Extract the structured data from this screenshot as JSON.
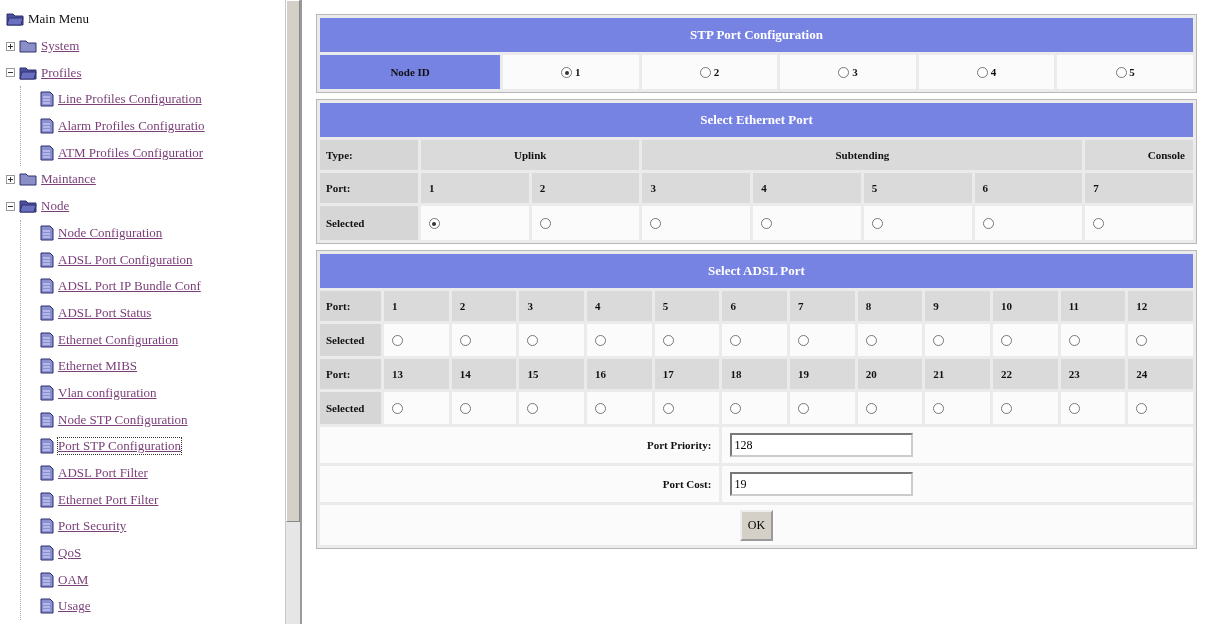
{
  "tree": {
    "label": "Main Menu",
    "children": [
      {
        "label": "System",
        "kind": "folder",
        "expanded": false
      },
      {
        "label": "Profiles",
        "kind": "folder",
        "expanded": true,
        "children": [
          {
            "label": "Line Profiles Configuration",
            "kind": "page"
          },
          {
            "label": "Alarm Profiles Configuratio",
            "kind": "page"
          },
          {
            "label": "ATM Profiles Configuratior",
            "kind": "page"
          }
        ]
      },
      {
        "label": "Maintance",
        "kind": "folder",
        "expanded": false
      },
      {
        "label": "Node",
        "kind": "folder",
        "expanded": true,
        "children": [
          {
            "label": "Node Configuration",
            "kind": "page"
          },
          {
            "label": "ADSL Port Configuration",
            "kind": "page"
          },
          {
            "label": "ADSL Port IP Bundle Conf",
            "kind": "page"
          },
          {
            "label": "ADSL Port Status",
            "kind": "page"
          },
          {
            "label": "Ethernet Configuration",
            "kind": "page"
          },
          {
            "label": "Ethernet MIBS",
            "kind": "page"
          },
          {
            "label": "Vlan configuration",
            "kind": "page"
          },
          {
            "label": "Node STP Configuration",
            "kind": "page"
          },
          {
            "label": "Port STP Configuration",
            "kind": "page",
            "selected": true
          },
          {
            "label": "ADSL Port Filter",
            "kind": "page"
          },
          {
            "label": "Ethernet Port Filter",
            "kind": "page"
          },
          {
            "label": "Port Security",
            "kind": "page"
          },
          {
            "label": "QoS",
            "kind": "page"
          },
          {
            "label": "OAM",
            "kind": "page"
          },
          {
            "label": "Usage",
            "kind": "page"
          }
        ]
      }
    ]
  },
  "stp": {
    "title": "STP Port Configuration",
    "node_label": "Node ID",
    "nodes": [
      {
        "label": "1",
        "selected": true
      },
      {
        "label": "2",
        "selected": false
      },
      {
        "label": "3",
        "selected": false
      },
      {
        "label": "4",
        "selected": false
      },
      {
        "label": "5",
        "selected": false
      }
    ]
  },
  "ethernet": {
    "title": "Select Ethernet Port",
    "type_label": "Type:",
    "port_label": "Port:",
    "selected_label": "Selected",
    "groups": [
      {
        "type": "Uplink",
        "ports": [
          {
            "port": "1",
            "selected": true
          },
          {
            "port": "2",
            "selected": false
          }
        ]
      },
      {
        "type": "Subtending",
        "ports": [
          {
            "port": "3",
            "selected": false
          },
          {
            "port": "4",
            "selected": false
          },
          {
            "port": "5",
            "selected": false
          },
          {
            "port": "6",
            "selected": false
          }
        ]
      },
      {
        "type": "Console",
        "ports": [
          {
            "port": "7",
            "selected": false
          }
        ]
      }
    ]
  },
  "adsl": {
    "title": "Select ADSL Port",
    "rows": [
      {
        "port_label": "Port:",
        "selected_label": "Selected",
        "ports": [
          {
            "port": "1",
            "selected": false
          },
          {
            "port": "2",
            "selected": false
          },
          {
            "port": "3",
            "selected": false
          },
          {
            "port": "4",
            "selected": false
          },
          {
            "port": "5",
            "selected": false
          },
          {
            "port": "6",
            "selected": false
          },
          {
            "port": "7",
            "selected": false
          },
          {
            "port": "8",
            "selected": false
          },
          {
            "port": "9",
            "selected": false
          },
          {
            "port": "10",
            "selected": false
          },
          {
            "port": "11",
            "selected": false
          },
          {
            "port": "12",
            "selected": false
          }
        ]
      },
      {
        "port_label": "Port:",
        "selected_label": "Selected",
        "ports": [
          {
            "port": "13",
            "selected": false
          },
          {
            "port": "14",
            "selected": false
          },
          {
            "port": "15",
            "selected": false
          },
          {
            "port": "16",
            "selected": false
          },
          {
            "port": "17",
            "selected": false
          },
          {
            "port": "18",
            "selected": false
          },
          {
            "port": "19",
            "selected": false
          },
          {
            "port": "20",
            "selected": false
          },
          {
            "port": "21",
            "selected": false
          },
          {
            "port": "22",
            "selected": false
          },
          {
            "port": "23",
            "selected": false
          },
          {
            "port": "24",
            "selected": false
          }
        ]
      }
    ],
    "fields": [
      {
        "label": "Port Priority:",
        "value": "128"
      },
      {
        "label": "Port Cost:",
        "value": "19"
      }
    ],
    "button": "OK"
  }
}
